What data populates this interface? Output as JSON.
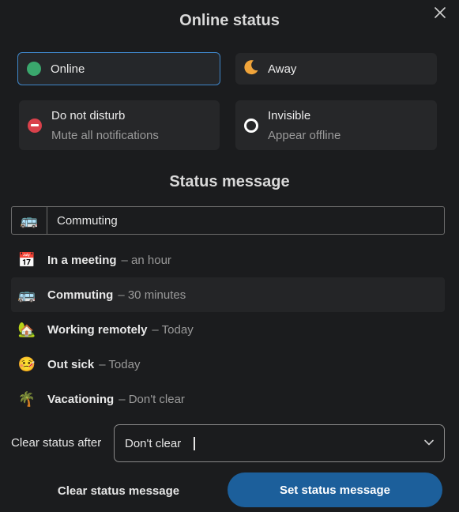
{
  "header": {
    "title": "Online status",
    "close_icon": "close-icon"
  },
  "statuses": {
    "online": {
      "label": "Online",
      "color": "#3aa76d",
      "selected": true
    },
    "away": {
      "label": "Away",
      "color": "#f0a43a"
    },
    "dnd": {
      "label": "Do not disturb",
      "sublabel": "Mute all notifications",
      "color": "#d9414b"
    },
    "invisible": {
      "label": "Invisible",
      "sublabel": "Appear offline"
    }
  },
  "status_message": {
    "title": "Status message",
    "emoji": "🚌",
    "value": "Commuting"
  },
  "presets": [
    {
      "emoji": "📅",
      "label": "In a meeting",
      "duration": "– an hour"
    },
    {
      "emoji": "🚌",
      "label": "Commuting",
      "duration": "– 30 minutes"
    },
    {
      "emoji": "🏡",
      "label": "Working remotely",
      "duration": "– Today"
    },
    {
      "emoji": "🤒",
      "label": "Out sick",
      "duration": "– Today"
    },
    {
      "emoji": "🌴",
      "label": "Vacationing",
      "duration": "– Don't clear"
    }
  ],
  "clear_after": {
    "label": "Clear status after",
    "value": "Don't clear"
  },
  "buttons": {
    "clear": "Clear status message",
    "set": "Set status message"
  },
  "colors": {
    "accent": "#1c5f9b",
    "selected_border": "#3f86c9",
    "background": "#1b1c1e"
  }
}
